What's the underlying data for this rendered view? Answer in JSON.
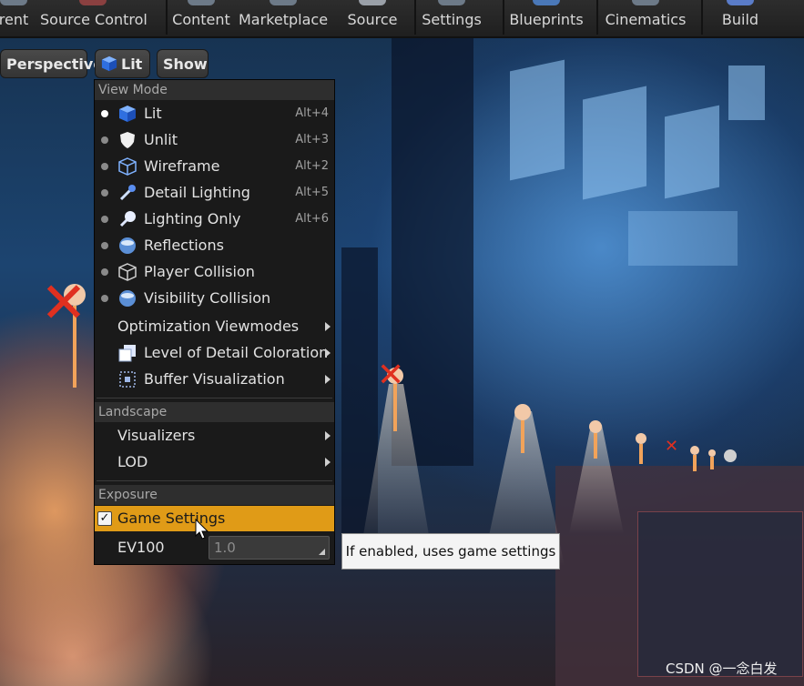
{
  "toolbar": {
    "items": [
      {
        "label": "rent",
        "icon": "play-icon"
      },
      {
        "label": "Source Control",
        "icon": "source-control-icon"
      },
      {
        "label": "Content",
        "icon": "content-icon"
      },
      {
        "label": "Marketplace",
        "icon": "marketplace-icon"
      },
      {
        "label": "Source",
        "icon": "source-icon"
      },
      {
        "label": "Settings",
        "icon": "settings-icon"
      },
      {
        "label": "Blueprints",
        "icon": "blueprints-icon"
      },
      {
        "label": "Cinematics",
        "icon": "cinematics-icon"
      },
      {
        "label": "Build",
        "icon": "build-icon"
      }
    ]
  },
  "viewport_toolbar": {
    "perspective": "Perspective",
    "lit": "Lit",
    "show": "Show"
  },
  "menu": {
    "view_mode_header": "View Mode",
    "view_modes": [
      {
        "label": "Lit",
        "shortcut": "Alt+4",
        "icon": "lit-cube-icon",
        "active": true
      },
      {
        "label": "Unlit",
        "shortcut": "Alt+3",
        "icon": "unlit-shield-icon",
        "active": false
      },
      {
        "label": "Wireframe",
        "shortcut": "Alt+2",
        "icon": "wireframe-cube-icon",
        "active": false
      },
      {
        "label": "Detail Lighting",
        "shortcut": "Alt+5",
        "icon": "detail-lighting-icon",
        "active": false
      },
      {
        "label": "Lighting Only",
        "shortcut": "Alt+6",
        "icon": "lighting-only-icon",
        "active": false
      },
      {
        "label": "Reflections",
        "shortcut": "",
        "icon": "reflections-sphere-icon",
        "active": false
      },
      {
        "label": "Player Collision",
        "shortcut": "",
        "icon": "player-collision-icon",
        "active": false
      },
      {
        "label": "Visibility Collision",
        "shortcut": "",
        "icon": "visibility-collision-icon",
        "active": false
      }
    ],
    "submenus": [
      {
        "label": "Optimization Viewmodes",
        "icon": ""
      },
      {
        "label": "Level of Detail Coloration",
        "icon": "lod-coloration-icon"
      },
      {
        "label": "Buffer Visualization",
        "icon": "buffer-visualization-icon"
      }
    ],
    "landscape_header": "Landscape",
    "landscape_items": [
      {
        "label": "Visualizers"
      },
      {
        "label": "LOD"
      }
    ],
    "exposure_header": "Exposure",
    "game_settings_label": "Game Settings",
    "game_settings_checked": true,
    "ev100_label": "EV100",
    "ev100_value": "1.0"
  },
  "tooltip": {
    "text": "If enabled, uses game settings"
  },
  "watermark": "CSDN @一念白发",
  "colors": {
    "highlight": "#e09b17",
    "menu_bg": "#1a1a1a",
    "header_bg": "#2e2e2e"
  }
}
